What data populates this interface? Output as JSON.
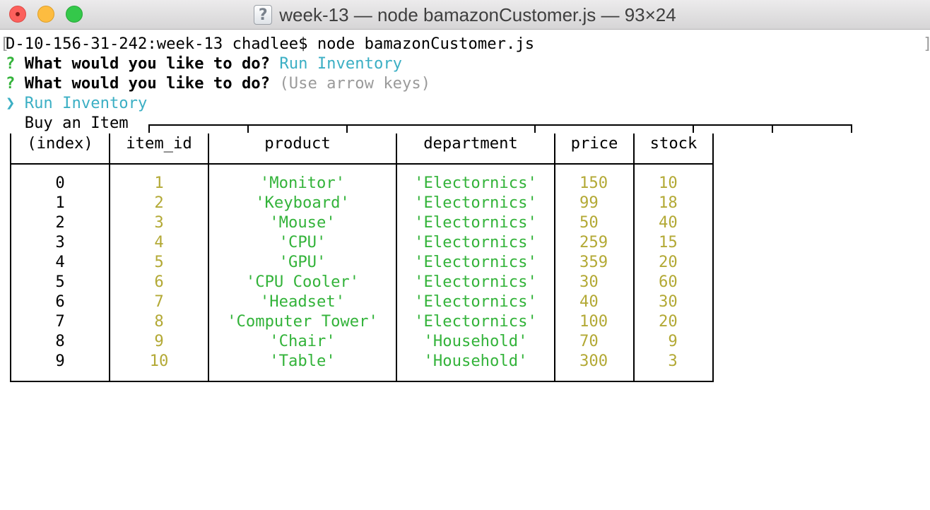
{
  "window": {
    "title": "week-13 — node bamazonCustomer.js — 93×24",
    "doc_icon": "?"
  },
  "terminal": {
    "command_line": "D-10-156-31-242:week-13 chadlee$ node bamazonCustomer.js",
    "prompt_marker": "?",
    "question": "What would you like to do?",
    "answer": "Run Inventory",
    "hint": "(Use arrow keys)",
    "pointer": "❯",
    "choices": [
      "Run Inventory",
      "Buy an Item"
    ]
  },
  "table": {
    "headers": [
      "(index)",
      "item_id",
      "product",
      "department",
      "price",
      "stock"
    ],
    "rows": [
      {
        "index": "0",
        "item_id": "1",
        "product": "'Monitor'",
        "department": "'Electornics'",
        "price": "150",
        "stock": "10"
      },
      {
        "index": "1",
        "item_id": "2",
        "product": "'Keyboard'",
        "department": "'Electornics'",
        "price": "99",
        "stock": "18"
      },
      {
        "index": "2",
        "item_id": "3",
        "product": "'Mouse'",
        "department": "'Electornics'",
        "price": "50",
        "stock": "40"
      },
      {
        "index": "3",
        "item_id": "4",
        "product": "'CPU'",
        "department": "'Electornics'",
        "price": "259",
        "stock": "15"
      },
      {
        "index": "4",
        "item_id": "5",
        "product": "'GPU'",
        "department": "'Electornics'",
        "price": "359",
        "stock": "20"
      },
      {
        "index": "5",
        "item_id": "6",
        "product": "'CPU Cooler'",
        "department": "'Electornics'",
        "price": "30",
        "stock": "60"
      },
      {
        "index": "6",
        "item_id": "7",
        "product": "'Headset'",
        "department": "'Electornics'",
        "price": "40",
        "stock": "30"
      },
      {
        "index": "7",
        "item_id": "8",
        "product": "'Computer Tower'",
        "department": "'Electornics'",
        "price": "100",
        "stock": "20"
      },
      {
        "index": "8",
        "item_id": "9",
        "product": "'Chair'",
        "department": "'Household'",
        "price": "70",
        "stock": "9"
      },
      {
        "index": "9",
        "item_id": "10",
        "product": "'Table'",
        "department": "'Household'",
        "price": "300",
        "stock": "3"
      }
    ]
  }
}
